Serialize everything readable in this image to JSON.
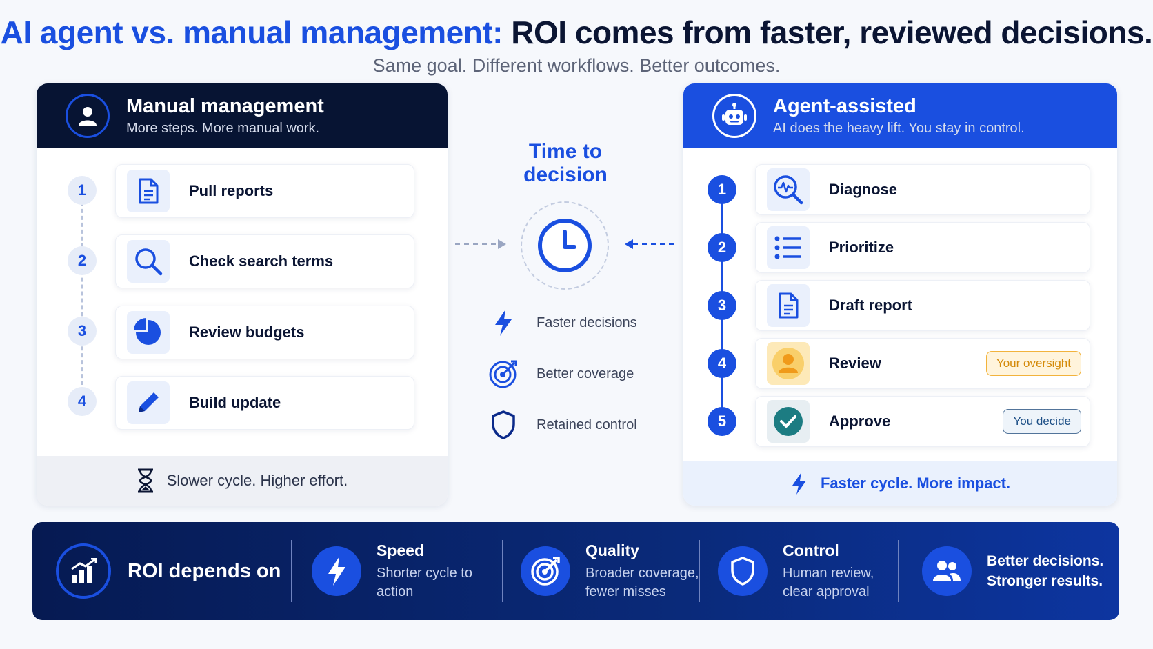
{
  "header": {
    "title_highlight": "AI agent vs. manual management:",
    "title_rest": "ROI comes from faster, reviewed decisions.",
    "subtitle": "Same goal. Different workflows. Better outcomes."
  },
  "manual": {
    "title": "Manual management",
    "subtitle": "More steps. More manual work.",
    "steps": [
      {
        "num": "1",
        "label": "Pull reports",
        "icon": "document-icon"
      },
      {
        "num": "2",
        "label": "Check search terms",
        "icon": "search-icon"
      },
      {
        "num": "3",
        "label": "Review budgets",
        "icon": "pie-chart-icon"
      },
      {
        "num": "4",
        "label": "Build update",
        "icon": "pencil-icon"
      }
    ],
    "footer": "Slower cycle. Higher effort.",
    "footer_icon": "hourglass-icon"
  },
  "middle": {
    "title": "Time to decision",
    "title_line1": "Time to",
    "title_line2": "decision",
    "items": [
      {
        "label": "Faster decisions",
        "icon": "lightning-icon"
      },
      {
        "label": "Better coverage",
        "icon": "target-icon"
      },
      {
        "label": "Retained control",
        "icon": "shield-icon"
      }
    ]
  },
  "agent": {
    "title": "Agent-assisted",
    "subtitle": "AI does the heavy lift. You stay in control.",
    "steps": [
      {
        "num": "1",
        "label": "Diagnose",
        "icon": "diagnose-icon"
      },
      {
        "num": "2",
        "label": "Prioritize",
        "icon": "list-icon"
      },
      {
        "num": "3",
        "label": "Draft report",
        "icon": "document-icon"
      },
      {
        "num": "4",
        "label": "Review",
        "icon": "person-icon",
        "tag": "Your oversight"
      },
      {
        "num": "5",
        "label": "Approve",
        "icon": "check-icon",
        "tag": "You decide"
      }
    ],
    "footer": "Faster cycle. More impact.",
    "footer_icon": "lightning-icon"
  },
  "banner": {
    "main": "ROI depends on",
    "items": [
      {
        "title": "Speed",
        "text": "Shorter cycle to action",
        "icon": "lightning-icon"
      },
      {
        "title": "Quality",
        "text": "Broader coverage, fewer misses",
        "icon": "target-icon"
      },
      {
        "title": "Control",
        "text": "Human review, clear approval",
        "icon": "shield-icon"
      }
    ],
    "final": "Better decisions. Stronger results.",
    "final_icon": "users-icon"
  },
  "colors": {
    "accent": "#1a4fe0",
    "navy": "#071433",
    "oversight": "#f2b33c",
    "approve": "#1c7c82"
  }
}
